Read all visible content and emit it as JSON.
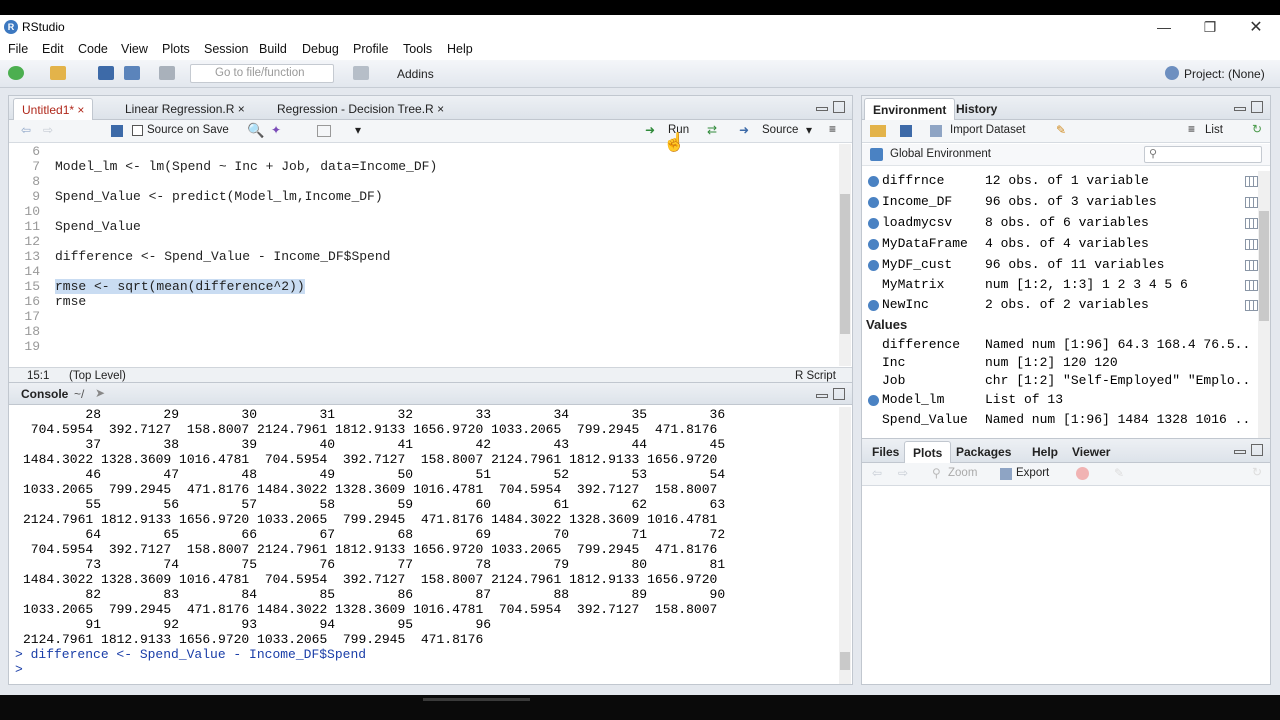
{
  "window": {
    "app_title": "RStudio",
    "logo": "R"
  },
  "menu": [
    "File",
    "Edit",
    "Code",
    "View",
    "Plots",
    "Session",
    "Build",
    "Debug",
    "Profile",
    "Tools",
    "Help"
  ],
  "toolbar": {
    "goto_placeholder": "Go to file/function",
    "addins": "Addins",
    "project": "Project: (None)"
  },
  "editor": {
    "tabs": [
      {
        "label": "Untitled1*"
      },
      {
        "label": "Linear Regression.R"
      },
      {
        "label": "Regression - Decision Tree.R"
      }
    ],
    "source_on_save": "Source on Save",
    "run": "Run",
    "source": "Source",
    "lines": [
      {
        "n": "6",
        "code": ""
      },
      {
        "n": "7",
        "code": "Model_lm <- lm(Spend ~ Inc + Job, data=Income_DF)"
      },
      {
        "n": "8",
        "code": ""
      },
      {
        "n": "9",
        "code": "Spend_Value <- predict(Model_lm,Income_DF)"
      },
      {
        "n": "10",
        "code": ""
      },
      {
        "n": "11",
        "code": "Spend_Value"
      },
      {
        "n": "12",
        "code": ""
      },
      {
        "n": "13",
        "code": "difference <- Spend_Value - Income_DF$Spend"
      },
      {
        "n": "14",
        "code": ""
      },
      {
        "n": "15",
        "code": "rmse <- sqrt(mean(difference^2))"
      },
      {
        "n": "16",
        "code": "rmse"
      },
      {
        "n": "17",
        "code": ""
      },
      {
        "n": "18",
        "code": ""
      },
      {
        "n": "19",
        "code": ""
      }
    ],
    "status_pos": "15:1",
    "status_scope": "(Top Level)",
    "status_type": "R Script"
  },
  "console": {
    "title": "Console",
    "path": "~/",
    "lines": [
      "        28        29        30        31        32        33        34        35        36",
      " 704.5954  392.7127  158.8007 2124.7961 1812.9133 1656.9720 1033.2065  799.2945  471.8176",
      "        37        38        39        40        41        42        43        44        45",
      "1484.3022 1328.3609 1016.4781  704.5954  392.7127  158.8007 2124.7961 1812.9133 1656.9720",
      "        46        47        48        49        50        51        52        53        54",
      "1033.2065  799.2945  471.8176 1484.3022 1328.3609 1016.4781  704.5954  392.7127  158.8007",
      "        55        56        57        58        59        60        61        62        63",
      "2124.7961 1812.9133 1656.9720 1033.2065  799.2945  471.8176 1484.3022 1328.3609 1016.4781",
      "        64        65        66        67        68        69        70        71        72",
      " 704.5954  392.7127  158.8007 2124.7961 1812.9133 1656.9720 1033.2065  799.2945  471.8176",
      "        73        74        75        76        77        78        79        80        81",
      "1484.3022 1328.3609 1016.4781  704.5954  392.7127  158.8007 2124.7961 1812.9133 1656.9720",
      "        82        83        84        85        86        87        88        89        90",
      "1033.2065  799.2945  471.8176 1484.3022 1328.3609 1016.4781  704.5954  392.7127  158.8007",
      "        91        92        93        94        95        96",
      "2124.7961 1812.9133 1656.9720 1033.2065  799.2945  471.8176"
    ],
    "last_cmd": "> difference <- Spend_Value - Income_DF$Spend",
    "prompt": "> "
  },
  "environment": {
    "tabs": [
      "Environment",
      "History"
    ],
    "import": "Import Dataset",
    "list": "List",
    "scope": "Global Environment",
    "data": [
      {
        "name": "diffrnce",
        "value": "12 obs. of 1 variable",
        "expand": true,
        "grid": true
      },
      {
        "name": "Income_DF",
        "value": "96 obs. of 3 variables",
        "expand": true,
        "grid": true
      },
      {
        "name": "loadmycsv",
        "value": "8 obs. of 6 variables",
        "expand": true,
        "grid": true
      },
      {
        "name": "MyDataFrame",
        "value": "4 obs. of 4 variables",
        "expand": true,
        "grid": true
      },
      {
        "name": "MyDF_cust",
        "value": "96 obs. of 11 variables",
        "expand": true,
        "grid": true
      },
      {
        "name": "MyMatrix",
        "value": "num [1:2, 1:3] 1 2 3 4 5 6",
        "expand": false,
        "grid": true
      },
      {
        "name": "NewInc",
        "value": "2 obs. of 2 variables",
        "expand": true,
        "grid": true
      }
    ],
    "values_header": "Values",
    "values": [
      {
        "name": "difference",
        "value": "Named num [1:96] 64.3 168.4 76.5...",
        "expand": false
      },
      {
        "name": "Inc",
        "value": "num [1:2] 120 120",
        "expand": false
      },
      {
        "name": "Job",
        "value": "chr [1:2] \"Self-Employed\" \"Emplo...",
        "expand": false
      },
      {
        "name": "Model_lm",
        "value": "List of 13",
        "expand": true
      },
      {
        "name": "Spend_Value",
        "value": "Named num [1:96] 1484 1328 1016 ...",
        "expand": false
      }
    ]
  },
  "files": {
    "tabs": [
      "Files",
      "Plots",
      "Packages",
      "Help",
      "Viewer"
    ],
    "active": "Plots",
    "zoom": "Zoom",
    "export": "Export"
  }
}
